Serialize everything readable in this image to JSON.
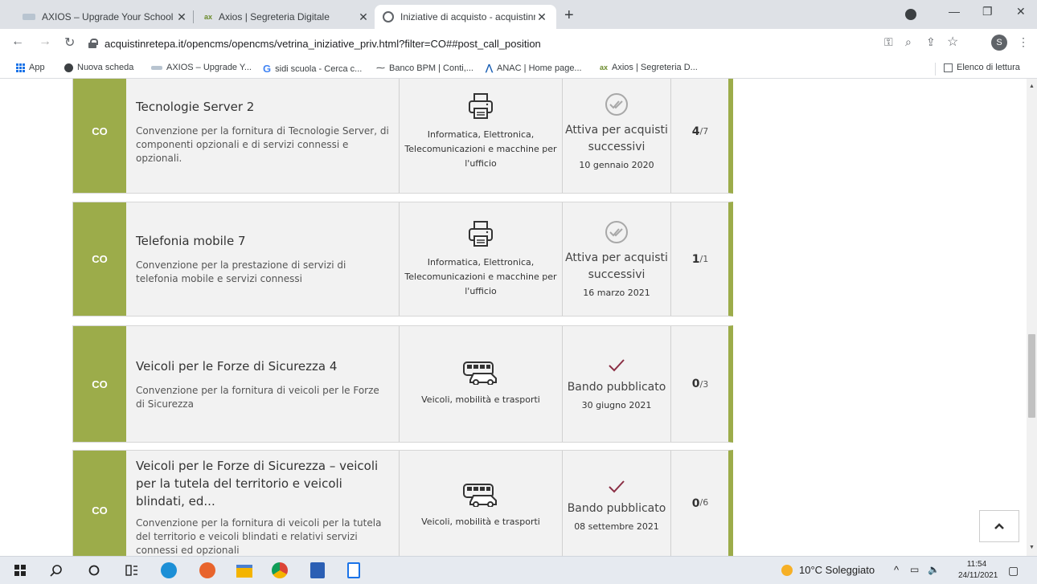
{
  "browser": {
    "tabs": [
      {
        "title": "AXIOS – Upgrade Your School",
        "active": false
      },
      {
        "title": "Axios | Segreteria Digitale",
        "active": false
      },
      {
        "title": "Iniziative di acquisto - acquistinre",
        "active": true
      }
    ],
    "url": "acquistinretepa.it/opencms/opencms/vetrina_iniziative_priv.html?filter=CO##post_call_position",
    "profile_initial": "S",
    "bookmarks": [
      {
        "label": "App",
        "icon": "apps-grid-icon"
      },
      {
        "label": "Nuova scheda",
        "icon": "globe-icon"
      },
      {
        "label": "AXIOS – Upgrade Y...",
        "icon": "axios-icon"
      },
      {
        "label": "sidi scuola - Cerca c...",
        "icon": "google-icon"
      },
      {
        "label": "Banco BPM | Conti,...",
        "icon": "bpm-icon"
      },
      {
        "label": "ANAC | Home page...",
        "icon": "anac-icon"
      },
      {
        "label": "Axios | Segreteria D...",
        "icon": "axios-segreteria-icon"
      }
    ],
    "reading_list": "Elenco di lettura"
  },
  "cards": [
    {
      "badge": "CO",
      "title": "Tecnologie Server 2",
      "desc": "Convenzione per la fornitura di Tecnologie Server, di componenti opzionali e di servizi connessi e opzionali.",
      "category": "Informatica, Elettronica, Telecomunicazioni e macchine per l'ufficio",
      "category_icon": "printer-icon",
      "status": "Attiva per acquisti successivi",
      "status_icon": "double-check-circle-icon",
      "date": "10 gennaio 2020",
      "count_num": "4",
      "count_den": "/7"
    },
    {
      "badge": "CO",
      "title": "Telefonia mobile 7",
      "desc": "Convenzione per la prestazione di servizi di telefonia mobile e servizi connessi",
      "category": "Informatica, Elettronica, Telecomunicazioni e macchine per l'ufficio",
      "category_icon": "printer-icon",
      "status": "Attiva per acquisti successivi",
      "status_icon": "double-check-circle-icon",
      "date": "16 marzo 2021",
      "count_num": "1",
      "count_den": "/1"
    },
    {
      "badge": "CO",
      "title": "Veicoli per le Forze di Sicurezza 4",
      "desc": "Convenzione per la fornitura di veicoli per le Forze di Sicurezza",
      "category": "Veicoli, mobilità e trasporti",
      "category_icon": "vehicles-icon",
      "status": "Bando pubblicato",
      "status_icon": "check-icon",
      "date": "30 giugno 2021",
      "count_num": "0",
      "count_den": "/3"
    },
    {
      "badge": "CO",
      "title": "Veicoli per le Forze di Sicurezza – veicoli per la tutela del territorio e veicoli blindati, ed...",
      "desc": "Convenzione per la fornitura di veicoli per la tutela del territorio e veicoli blindati e relativi servizi connessi ed opzionali",
      "category": "Veicoli, mobilità e trasporti",
      "category_icon": "vehicles-icon",
      "status": "Bando pubblicato",
      "status_icon": "check-icon",
      "date": "08 settembre 2021",
      "count_num": "0",
      "count_den": "/6"
    }
  ],
  "taskbar": {
    "weather": "10°C  Soleggiato",
    "time": "11:54",
    "date": "24/11/2021"
  },
  "colors": {
    "accent": "#9cac4a",
    "check_maroon": "#8b2f45"
  }
}
